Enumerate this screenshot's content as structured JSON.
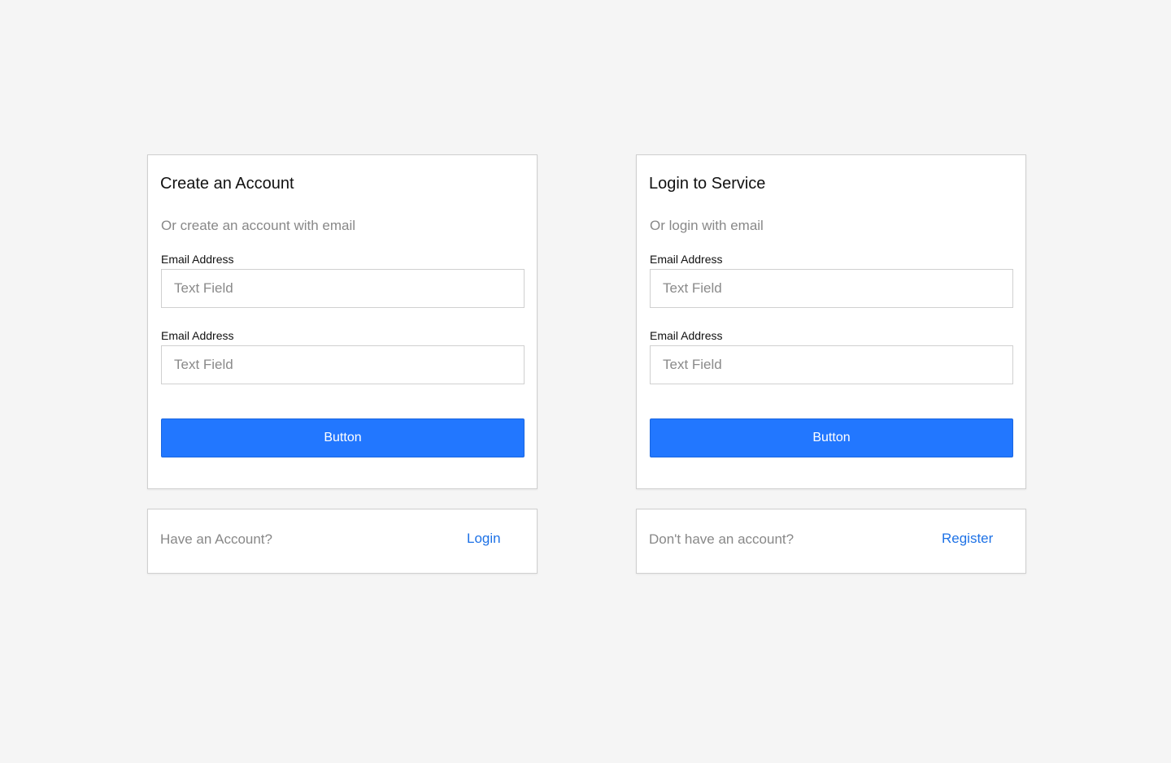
{
  "register_card": {
    "title": "Create an Account",
    "subtitle": "Or create an account with email",
    "fields": [
      {
        "label": "Email Address",
        "placeholder": "Text Field",
        "value": ""
      },
      {
        "label": "Email Address",
        "placeholder": "Text Field",
        "value": ""
      }
    ],
    "button_label": "Button"
  },
  "register_footer": {
    "prompt": "Have an Account?",
    "link_label": "Login"
  },
  "login_card": {
    "title": "Login to Service",
    "subtitle": "Or login with email",
    "fields": [
      {
        "label": "Email Address",
        "placeholder": "Text Field",
        "value": ""
      },
      {
        "label": "Email Address",
        "placeholder": "Text Field",
        "value": ""
      }
    ],
    "button_label": "Button"
  },
  "login_footer": {
    "prompt": "Don't have an account?",
    "link_label": "Register"
  },
  "colors": {
    "background": "#f5f5f5",
    "primary": "#2277ff",
    "link": "#1e72e6",
    "muted_text": "#888888"
  }
}
